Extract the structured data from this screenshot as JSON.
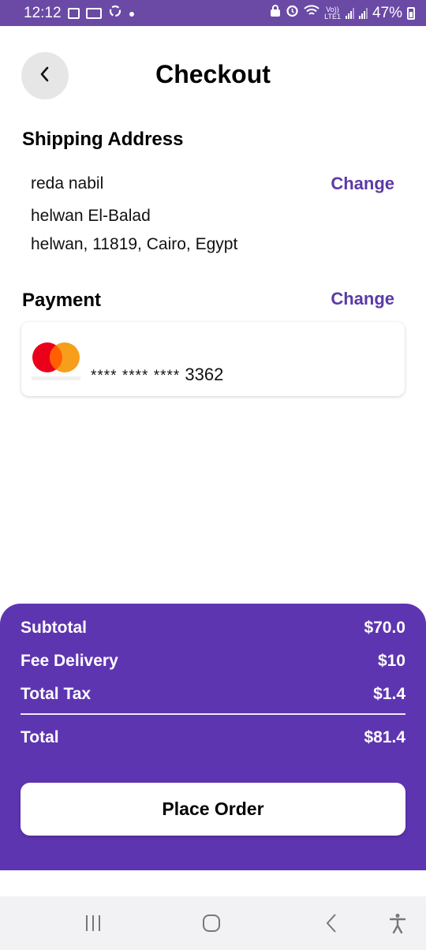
{
  "status_bar": {
    "time": "12:12",
    "battery": "47%",
    "left_icons": [
      "gallery-icon",
      "outlook-icon",
      "sync-icon",
      "dot-icon"
    ],
    "right_icons": [
      "lock-icon",
      "alarm-icon",
      "wifi-icon",
      "volte-icon",
      "signal-icon",
      "signal-icon",
      "battery-icon"
    ],
    "volte_label": "Vo))",
    "lte_label": "LTE1"
  },
  "header": {
    "title": "Checkout",
    "back_icon": "chevron-left-icon"
  },
  "shipping": {
    "title": "Shipping Address",
    "change_label": "Change",
    "name": "reda nabil",
    "line1": "helwan El-Balad",
    "line2": "helwan, 11819, Cairo, Egypt"
  },
  "payment": {
    "title": "Payment",
    "change_label": "Change",
    "card_brand": "mastercard",
    "masked_prefix": "**** **** ****",
    "last4": "3362"
  },
  "summary": {
    "rows": [
      {
        "label": "Subtotal",
        "value": "$70.0"
      },
      {
        "label": "Fee Delivery",
        "value": "$10"
      },
      {
        "label": "Total Tax",
        "value": "$1.4"
      }
    ],
    "total_label": "Total",
    "total_value": "$81.4",
    "button_label": "Place Order"
  },
  "nav_bar": {
    "icons": [
      "recent-apps-icon",
      "home-icon",
      "back-icon",
      "accessibility-icon"
    ]
  },
  "colors": {
    "status_bar": "#6a4aa5",
    "accent": "#5e35b1",
    "link": "#5b3aa6",
    "mastercard_red": "#eb001b",
    "mastercard_orange": "#f79e1b"
  }
}
